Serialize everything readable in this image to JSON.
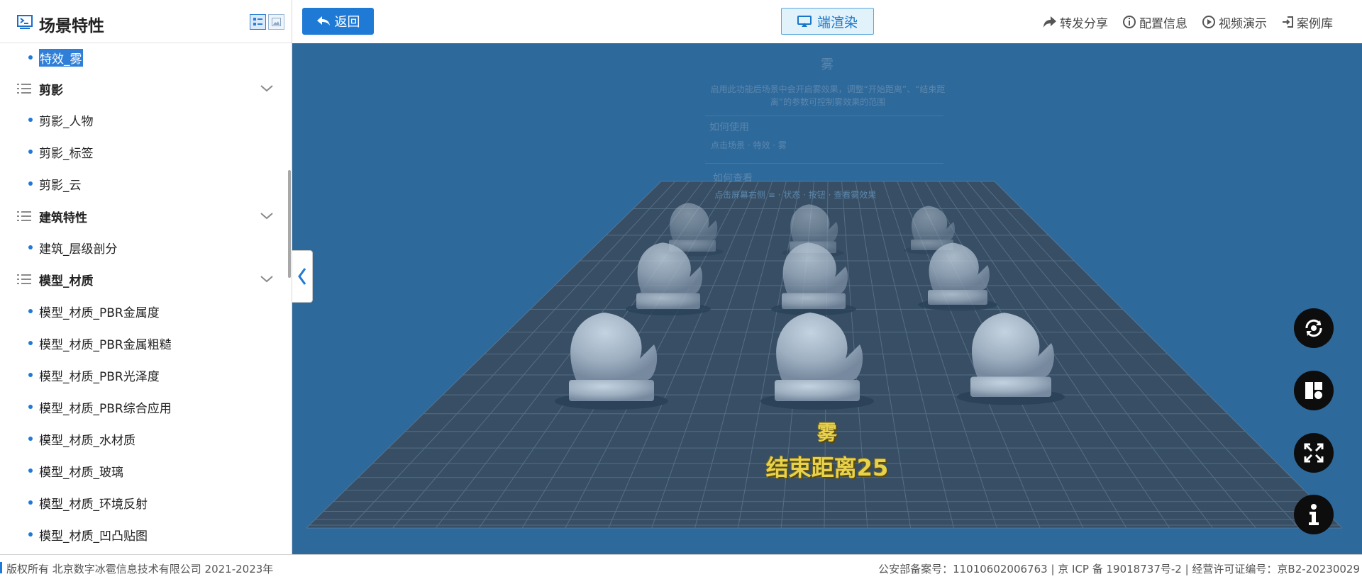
{
  "sidebar": {
    "title": "场景特性",
    "selected_item": "特效_雾",
    "items": [
      {
        "type": "item",
        "label": "特效_雾"
      },
      {
        "type": "category",
        "label": "剪影"
      },
      {
        "type": "item",
        "label": "剪影_人物"
      },
      {
        "type": "item",
        "label": "剪影_标签"
      },
      {
        "type": "item",
        "label": "剪影_云"
      },
      {
        "type": "category",
        "label": "建筑特性"
      },
      {
        "type": "item",
        "label": "建筑_层级剖分"
      },
      {
        "type": "category",
        "label": "模型_材质"
      },
      {
        "type": "item",
        "label": "模型_材质_PBR金属度"
      },
      {
        "type": "item",
        "label": "模型_材质_PBR金属粗糙"
      },
      {
        "type": "item",
        "label": "模型_材质_PBR光泽度"
      },
      {
        "type": "item",
        "label": "模型_材质_PBR综合应用"
      },
      {
        "type": "item",
        "label": "模型_材质_水材质"
      },
      {
        "type": "item",
        "label": "模型_材质_玻璃"
      },
      {
        "type": "item",
        "label": "模型_材质_环境反射"
      },
      {
        "type": "item",
        "label": "模型_材质_凹凸贴图"
      }
    ]
  },
  "toolbar": {
    "back_label": "返回",
    "render_label": "端渲染",
    "links": [
      {
        "label": "转发分享",
        "icon": "share-icon"
      },
      {
        "label": "配置信息",
        "icon": "info-circle-icon"
      },
      {
        "label": "视频演示",
        "icon": "play-circle-icon"
      },
      {
        "label": "案例库",
        "icon": "login-icon"
      }
    ]
  },
  "scene": {
    "panel_title": "雾",
    "panel_desc": "启用此功能后场景中会开启雾效果，调整“开始距离”、“结束距离”的参数可控制雾效果的范围",
    "how_use_title": "如何使用",
    "how_use_text": "点击场景 · 特效 · 雾",
    "how_view_title": "如何查看",
    "how_view_text": "点击屏幕右侧 ≡ · 状态 · 按钮 · 查看雾效果",
    "fog_label": "雾",
    "distance_label": "结束距离25",
    "side_buttons": [
      "rotate-icon",
      "layout-icon",
      "fullscreen-icon",
      "info-icon"
    ]
  },
  "footer": {
    "copyright": "版权所有 北京数字冰雹信息技术有限公司 2021-2023年",
    "license": "公安部备案号：11010602006763 | 京 ICP 备 19018737号-2 | 经营许可证编号：京B2-20230029"
  },
  "colors": {
    "accent": "#1f7ad6",
    "viewport_bg": "#2f6a9b",
    "label_yellow": "#e8d24a"
  }
}
